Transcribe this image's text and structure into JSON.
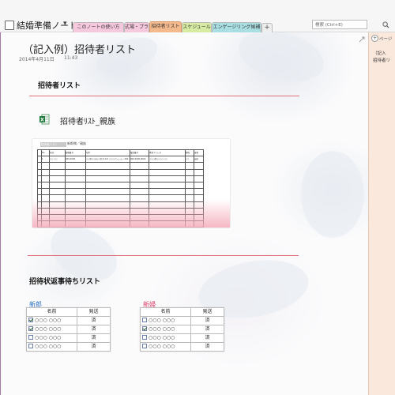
{
  "app": {
    "notebook_title": "結婚準備ノート",
    "tabs": [
      {
        "label": "このノートの使い方",
        "color": "#f6c9de"
      },
      {
        "label": "式場・プラン",
        "color": "#f6c9de"
      },
      {
        "label": "招待者リスト",
        "color": "#f4b98c"
      },
      {
        "label": "スケジュール",
        "color": "#d7eca2"
      },
      {
        "label": "エンゲージリング候補",
        "color": "#a9dfe2"
      }
    ],
    "add_tab_label": "+",
    "search_placeholder": "検索 (Ctrl+E)"
  },
  "page": {
    "title": "（記入例）招待者リスト",
    "date": "2014年4月11日",
    "time": "11:43",
    "section1_heading": "招待者リスト",
    "attachment_label": "招待者ﾘｽﾄ_親族",
    "preview": {
      "sheet_tab": "招待者リスト",
      "sheet_title": "新郎側／親族",
      "headers": [
        "No.",
        "名前",
        "郵便番号",
        "住所",
        "電話番号",
        "携帯アドレス",
        "関係",
        "返事"
      ],
      "row1": [
        "1",
        "○○ ○○",
        "000-0000",
        "○○県○○市○○町 0-0-0 ○○○マンション 000",
        "000-0000-0000",
        "○○○@○○○○.○○",
        "○○",
        "出席"
      ]
    },
    "section2_heading": "招待状返事待ちリスト",
    "groom": {
      "label": "新郎",
      "label_color": "#2a6ebf",
      "col_name": "名前",
      "col_sent": "発送",
      "rows": [
        {
          "name": "○○○ ○○○",
          "sent": "済",
          "checked": true
        },
        {
          "name": "○○○ ○○○",
          "sent": "済",
          "checked": true
        },
        {
          "name": "○○○ ○○○",
          "sent": "済",
          "checked": false
        },
        {
          "name": "○○○ ○○○",
          "sent": "済",
          "checked": false
        }
      ]
    },
    "bride": {
      "label": "新婦",
      "label_color": "#e0406a",
      "col_name": "名前",
      "col_sent": "発送",
      "rows": [
        {
          "name": "○○○ ○○○",
          "sent": "済",
          "checked": false
        },
        {
          "name": "○○○ ○○○",
          "sent": "済",
          "checked": true
        },
        {
          "name": "○○○ ○○○",
          "sent": "済",
          "checked": false
        },
        {
          "name": "○○○ ○○○",
          "sent": "済",
          "checked": false
        }
      ]
    }
  },
  "right_panel": {
    "add_page_label": "ページ",
    "items": [
      "（記入",
      "招待者リ"
    ]
  },
  "colors": {
    "accent_rule": "#e0707a",
    "right_panel_bg": "#fbe8dc"
  }
}
